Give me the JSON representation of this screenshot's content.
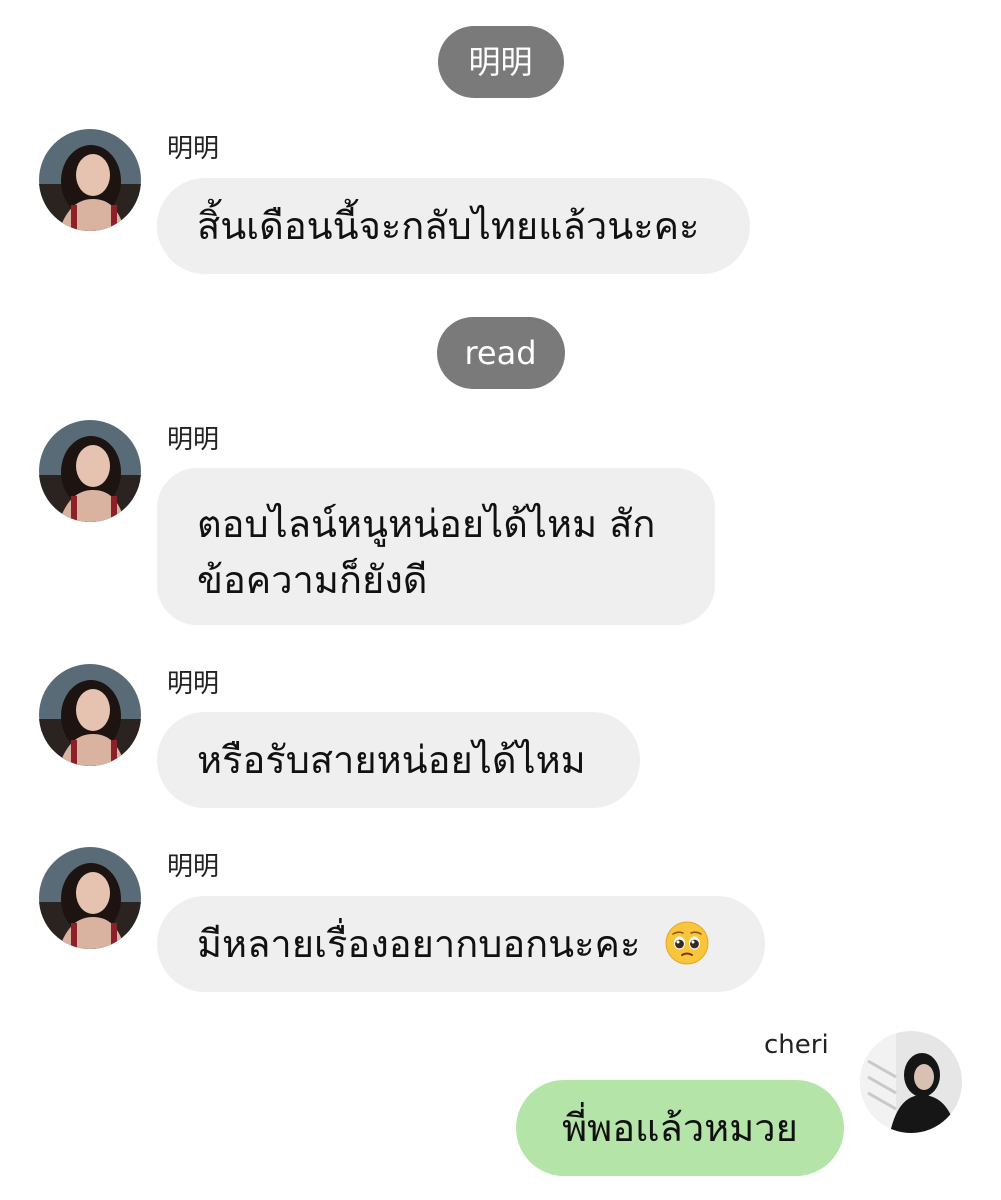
{
  "chat": {
    "header_name": "明明",
    "read_label": "read"
  },
  "messages": [
    {
      "sender": "明明",
      "text": "สิ้นเดือนนี้จะกลับไทยแล้วนะคะ"
    },
    {
      "sender": "明明",
      "text_line1": "ตอบไลน์หนูหน่อยได้ไหม สัก",
      "text_line2": "ข้อความก็ยังดี"
    },
    {
      "sender": "明明",
      "text": "หรือรับสายหน่อยได้ไหม"
    },
    {
      "sender": "明明",
      "text": "มีหลายเรื่องอยากบอกนะคะ",
      "emoji": "pleading-face-emoji"
    },
    {
      "sender": "cheri",
      "text": "พี่พอแล้วหมวย"
    }
  ],
  "colors": {
    "pill_bg": "#7a7a7a",
    "incoming_bubble": "#efefef",
    "outgoing_bubble": "#b5e4a8",
    "background": "#ffffff"
  }
}
